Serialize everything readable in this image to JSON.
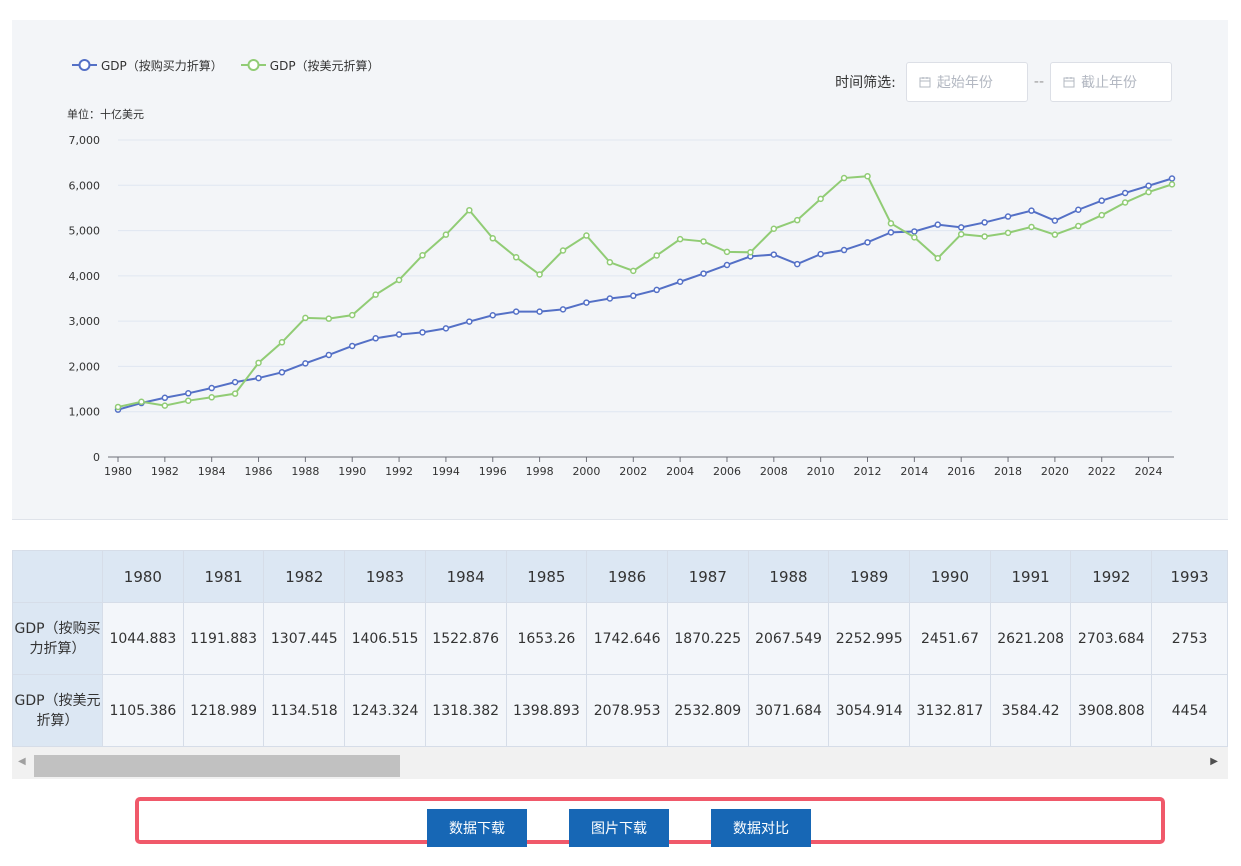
{
  "colors": {
    "ppp": "#5470c6",
    "usd": "#91cc75",
    "button": "#1767b5",
    "highlight": "#f0596a"
  },
  "legend": [
    {
      "label": "GDP（按购买力折算）",
      "color": "#5470c6"
    },
    {
      "label": "GDP（按美元折算）",
      "color": "#91cc75"
    }
  ],
  "filter": {
    "label": "时间筛选:",
    "start_placeholder": "起始年份",
    "separator": "--",
    "end_placeholder": "截止年份",
    "icon": "calendar-icon"
  },
  "unit_label": "单位：十亿美元",
  "chart_data": {
    "type": "line",
    "title": "",
    "xlabel": "",
    "ylabel": "单位：十亿美元",
    "ylim": [
      0,
      7000
    ],
    "yticks": [
      "0",
      "1,000",
      "2,000",
      "3,000",
      "4,000",
      "5,000",
      "6,000",
      "7,000"
    ],
    "x": [
      1980,
      1981,
      1982,
      1983,
      1984,
      1985,
      1986,
      1987,
      1988,
      1989,
      1990,
      1991,
      1992,
      1993,
      1994,
      1995,
      1996,
      1997,
      1998,
      1999,
      2000,
      2001,
      2002,
      2003,
      2004,
      2005,
      2006,
      2007,
      2008,
      2009,
      2010,
      2011,
      2012,
      2013,
      2014,
      2015,
      2016,
      2017,
      2018,
      2019,
      2020,
      2021,
      2022,
      2023,
      2024,
      2025
    ],
    "xtick_labels": [
      "1980",
      "1982",
      "1984",
      "1986",
      "1988",
      "1990",
      "1992",
      "1994",
      "1996",
      "1998",
      "2000",
      "2002",
      "2004",
      "2006",
      "2008",
      "2010",
      "2012",
      "2014",
      "2016",
      "2018",
      "2020",
      "2022",
      "2024"
    ],
    "grid": true,
    "legend_position": "top-left",
    "series": [
      {
        "name": "GDP（按购买力折算）",
        "values": [
          1044.883,
          1191.883,
          1307.445,
          1406.515,
          1522.876,
          1653.26,
          1742.646,
          1870.225,
          2067.549,
          2252.995,
          2451.67,
          2621.208,
          2703.684,
          2753,
          2840,
          2990,
          3130,
          3210,
          3210,
          3260,
          3410,
          3500,
          3560,
          3690,
          3870,
          4050,
          4240,
          4430,
          4470,
          4260,
          4480,
          4570,
          4740,
          4960,
          4980,
          5130,
          5070,
          5180,
          5310,
          5440,
          5220,
          5460,
          5660,
          5830,
          5990,
          6150
        ]
      },
      {
        "name": "GDP（按美元折算）",
        "values": [
          1105.386,
          1218.989,
          1134.518,
          1243.324,
          1318.382,
          1398.893,
          2078.953,
          2532.809,
          3071.684,
          3054.914,
          3132.817,
          3584.42,
          3908.808,
          4454,
          4910,
          5450,
          4830,
          4410,
          4030,
          4560,
          4890,
          4300,
          4110,
          4450,
          4810,
          4760,
          4530,
          4520,
          5040,
          5230,
          5700,
          6160,
          6200,
          5160,
          4850,
          4390,
          4920,
          4870,
          4950,
          5080,
          4910,
          5100,
          5340,
          5620,
          5850,
          6020
        ]
      }
    ]
  },
  "table": {
    "years": [
      "1980",
      "1981",
      "1982",
      "1983",
      "1984",
      "1985",
      "1986",
      "1987",
      "1988",
      "1989",
      "1990",
      "1991",
      "1992",
      "1993"
    ],
    "rows": [
      {
        "label": "GDP（按购买力折算）",
        "values": [
          "1044.883",
          "1191.883",
          "1307.445",
          "1406.515",
          "1522.876",
          "1653.26",
          "1742.646",
          "1870.225",
          "2067.549",
          "2252.995",
          "2451.67",
          "2621.208",
          "2703.684",
          "2753"
        ]
      },
      {
        "label": "GDP（按美元折算）",
        "values": [
          "1105.386",
          "1218.989",
          "1134.518",
          "1243.324",
          "1318.382",
          "1398.893",
          "2078.953",
          "2532.809",
          "3071.684",
          "3054.914",
          "3132.817",
          "3584.42",
          "3908.808",
          "4454"
        ]
      }
    ]
  },
  "scrollbar": {
    "left_arrow": "◀",
    "right_arrow": "▶"
  },
  "buttons": {
    "download_data": "数据下载",
    "download_image": "图片下载",
    "compare": "数据对比"
  }
}
